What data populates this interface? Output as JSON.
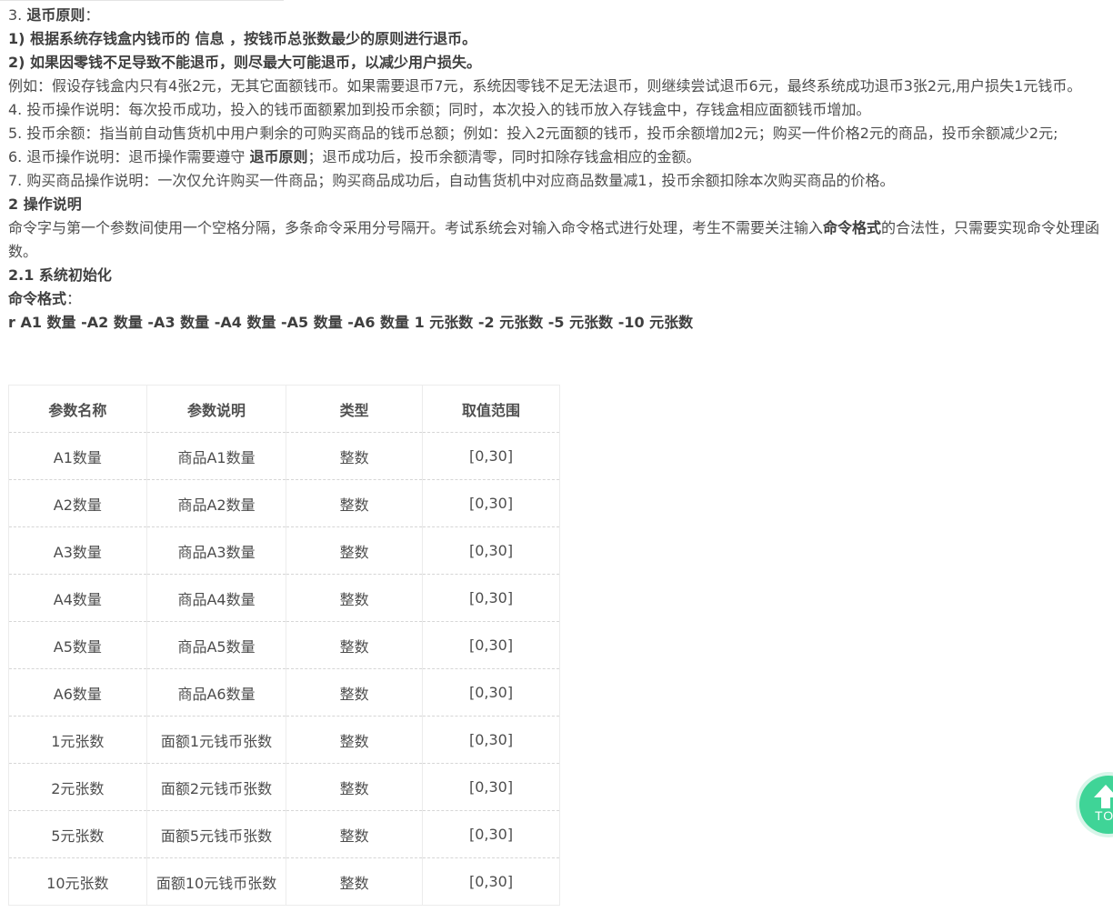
{
  "refund_principle": {
    "heading_prefix": "3. ",
    "heading": "退币原则",
    "heading_suffix": "：",
    "rule1": "1) 根据系统存钱盒内钱币的 信息 ，按钱币总张数最少的原则进行退币。",
    "rule2": "2) 如果因零钱不足导致不能退币，则尽最大可能退币，以减少用户损失。",
    "example": "例如：假设存钱盒内只有4张2元，无其它面额钱币。如果需要退币7元，系统因零钱不足无法退币，则继续尝试退币6元，最终系统成功退币3张2元,用户损失1元钱币。"
  },
  "notes": {
    "n4": "4. 投币操作说明：每次投币成功，投入的钱币面额累加到投币余额；同时，本次投入的钱币放入存钱盒中，存钱盒相应面额钱币增加。",
    "n5": "5. 投币余额：指当前自动售货机中用户剩余的可购买商品的钱币总额；例如：投入2元面额的钱币，投币余额增加2元；购买一件价格2元的商品，投币余额减少2元;",
    "n6_prefix": "6. 退币操作说明：退币操作需要遵守 ",
    "n6_bold": "退币原则",
    "n6_suffix": "；退币成功后，投币余额清零，同时扣除存钱盒相应的金额。",
    "n7": "7. 购买商品操作说明：一次仅允许购买一件商品；购买商品成功后，自动售货机中对应商品数量减1，投币余额扣除本次购买商品的价格。"
  },
  "operations": {
    "heading": "2 操作说明",
    "desc_prefix": "命令字与第一个参数间使用一个空格分隔，多条命令采用分号隔开。考试系统会对输入命令格式进行处理，考生不需要关注输入",
    "desc_bold": "命令格式",
    "desc_suffix": "的合法性，只需要实现命令处理函数。"
  },
  "init": {
    "heading": "2.1 系统初始化",
    "format_label": "命令格式",
    "format_colon": "：",
    "command": "r A1 数量 -A2 数量 -A3 数量 -A4 数量 -A5 数量 -A6 数量 1 元张数 -2 元张数 -5 元张数 -10 元张数"
  },
  "table": {
    "headers": [
      "参数名称",
      "参数说明",
      "类型",
      "取值范围"
    ],
    "rows": [
      [
        "A1数量",
        "商品A1数量",
        "整数",
        "[0,30]"
      ],
      [
        "A2数量",
        "商品A2数量",
        "整数",
        "[0,30]"
      ],
      [
        "A3数量",
        "商品A3数量",
        "整数",
        "[0,30]"
      ],
      [
        "A4数量",
        "商品A4数量",
        "整数",
        "[0,30]"
      ],
      [
        "A5数量",
        "商品A5数量",
        "整数",
        "[0,30]"
      ],
      [
        "A6数量",
        "商品A6数量",
        "整数",
        "[0,30]"
      ],
      [
        "1元张数",
        "面额1元钱币张数",
        "整数",
        "[0,30]"
      ],
      [
        "2元张数",
        "面额2元钱币张数",
        "整数",
        "[0,30]"
      ],
      [
        "5元张数",
        "面额5元钱币张数",
        "整数",
        "[0,30]"
      ],
      [
        "10元张数",
        "面额10元钱币张数",
        "整数",
        "[0,30]"
      ]
    ]
  },
  "to_top": {
    "label": "TO",
    "icon": "arrow-up-icon",
    "color": "#3fd497"
  }
}
